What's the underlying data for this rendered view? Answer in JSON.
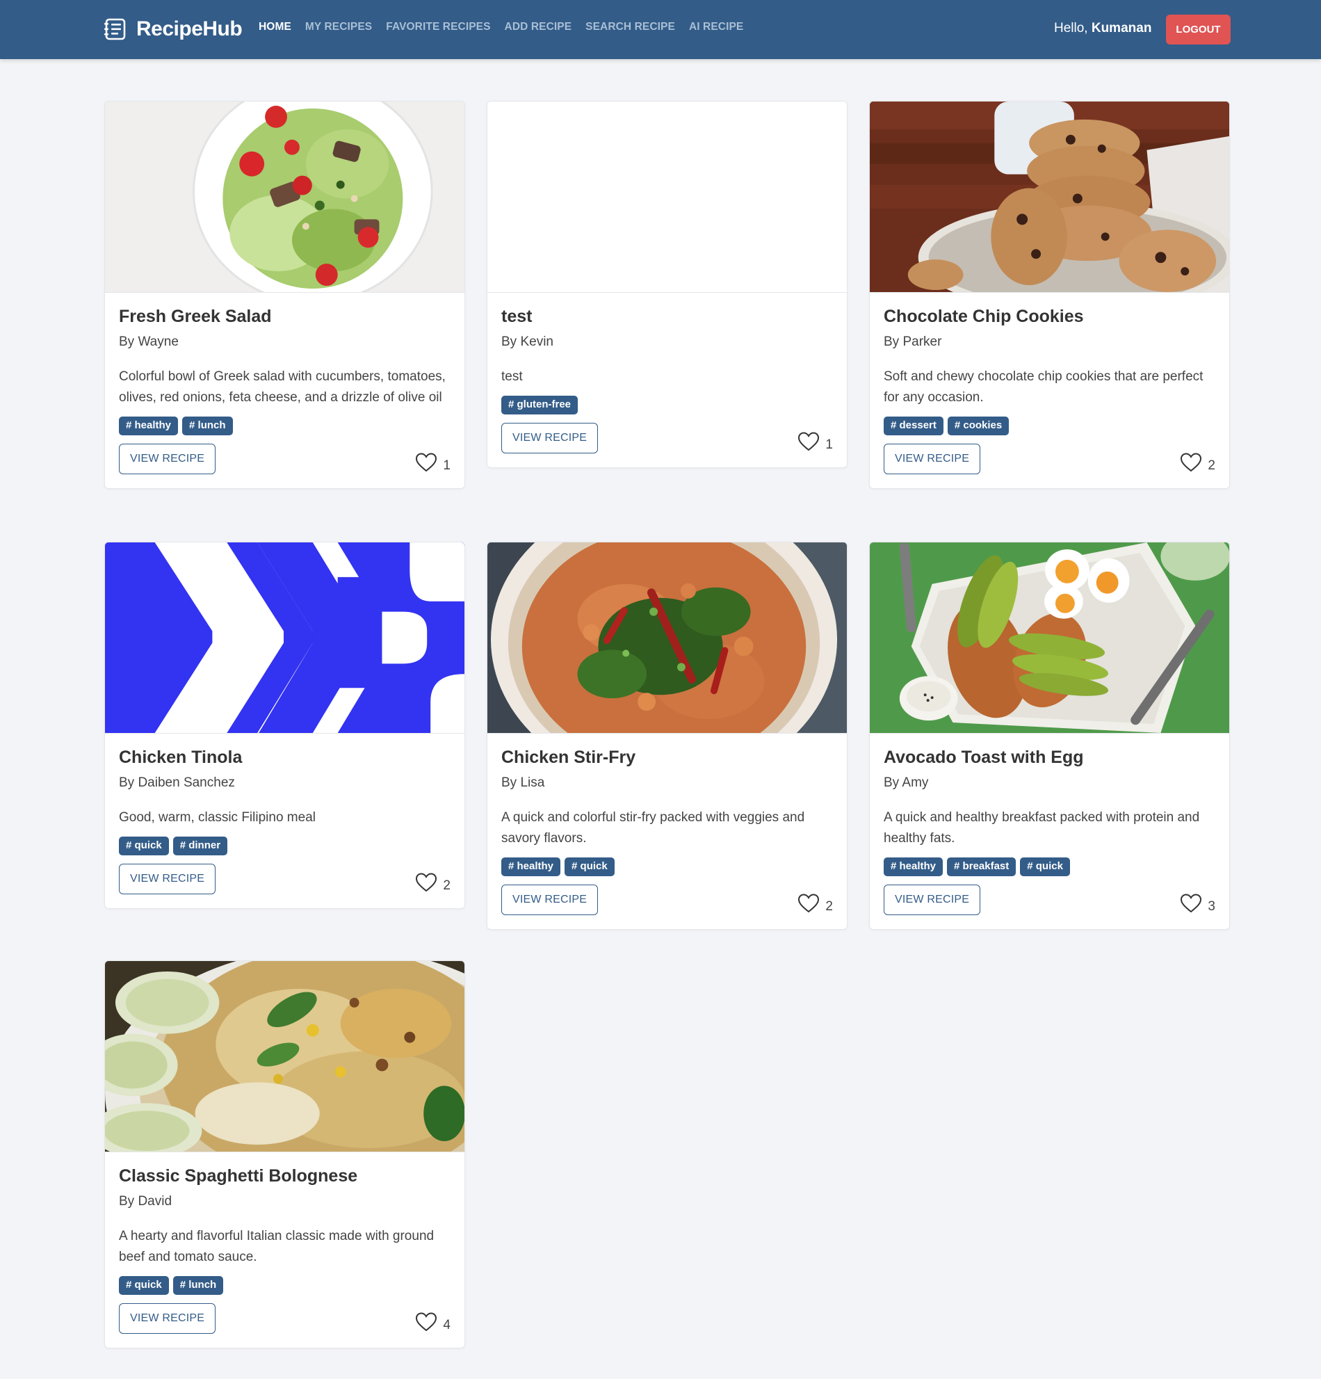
{
  "app": {
    "name": "RecipeHub",
    "brand_icon": "recipe-list-icon"
  },
  "nav": {
    "items": [
      {
        "label": "HOME",
        "active": true
      },
      {
        "label": "MY RECIPES",
        "active": false
      },
      {
        "label": "FAVORITE RECIPES",
        "active": false
      },
      {
        "label": "ADD RECIPE",
        "active": false
      },
      {
        "label": "SEARCH RECIPE",
        "active": false
      },
      {
        "label": "AI RECIPE",
        "active": false
      }
    ],
    "greeting_prefix": "Hello, ",
    "username": "Kumanan",
    "logout_label": "LOGOUT"
  },
  "colors": {
    "navbar": "#335c88",
    "tag": "#335c88",
    "logout": "#e05454",
    "background": "#f3f4f7"
  },
  "recipes": [
    {
      "title": "Fresh Greek Salad",
      "author": "By Wayne",
      "description": "Colorful bowl of Greek salad with cucumbers, tomatoes, olives, red onions, feta cheese, and a drizzle of olive oil",
      "tags": [
        "# healthy",
        "# lunch"
      ],
      "button": "VIEW RECIPE",
      "likes": "1",
      "image": "greek-salad-photo"
    },
    {
      "title": "test",
      "author": "By Kevin",
      "description": "test",
      "tags": [
        "# gluten-free"
      ],
      "button": "VIEW RECIPE",
      "likes": "1",
      "image": "blank-image"
    },
    {
      "title": "Chocolate Chip Cookies",
      "author": "By Parker",
      "description": "Soft and chewy chocolate chip cookies that are perfect for any occasion.",
      "tags": [
        "# dessert",
        "# cookies"
      ],
      "button": "VIEW RECIPE",
      "likes": "2",
      "image": "cookies-photo"
    },
    {
      "title": "Chicken Tinola",
      "author": "By Daiben Sanchez",
      "description": "Good, warm, classic Filipino meal",
      "tags": [
        "# quick",
        "# dinner"
      ],
      "button": "VIEW RECIPE",
      "likes": "2",
      "image": "blue-logo-graphic"
    },
    {
      "title": "Chicken Stir-Fry",
      "author": "By Lisa",
      "description": "A quick and colorful stir-fry packed with veggies and savory flavors.",
      "tags": [
        "# healthy",
        "# quick"
      ],
      "button": "VIEW RECIPE",
      "likes": "2",
      "image": "stir-fry-photo"
    },
    {
      "title": "Avocado Toast with Egg",
      "author": "By Amy",
      "description": "A quick and healthy breakfast packed with protein and healthy fats.",
      "tags": [
        "# healthy",
        "# breakfast",
        "# quick"
      ],
      "button": "VIEW RECIPE",
      "likes": "3",
      "image": "avocado-toast-photo"
    },
    {
      "title": "Classic Spaghetti Bolognese",
      "author": "By David",
      "description": "A hearty and flavorful Italian classic made with ground beef and tomato sauce.",
      "tags": [
        "# quick",
        "# lunch"
      ],
      "button": "VIEW RECIPE",
      "likes": "4",
      "image": "biryani-photo"
    }
  ]
}
